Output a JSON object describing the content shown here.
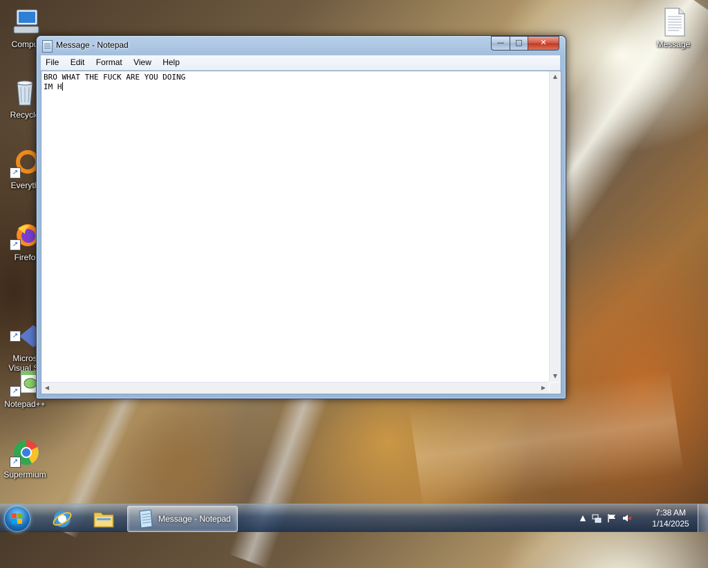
{
  "desktop": {
    "icons": [
      {
        "label": "Compu",
        "icon": "computer-icon"
      },
      {
        "label": "Recycle",
        "icon": "recycle-bin-icon"
      },
      {
        "label": "Everyth",
        "icon": "everything-search-icon"
      },
      {
        "label": "Firefo",
        "icon": "firefox-icon"
      },
      {
        "label": "Micros\nVisual St",
        "icon": "visual-studio-icon"
      },
      {
        "label": "Notepad++",
        "icon": "notepad-plus-plus-icon"
      },
      {
        "label": "Supermium",
        "icon": "supermium-browser-icon"
      },
      {
        "label": "Message",
        "icon": "text-file-icon"
      }
    ]
  },
  "window": {
    "title": "Message - Notepad",
    "controls": {
      "minimize": "—",
      "maximize": "□",
      "close": "✕"
    },
    "menu": [
      "File",
      "Edit",
      "Format",
      "View",
      "Help"
    ],
    "content_line1": "BRO WHAT THE FUCK ARE YOU DOING",
    "content_line2": "IM H"
  },
  "taskbar": {
    "active_task": "Message - Notepad",
    "clock_time": "7:38 AM",
    "clock_date": "1/14/2025",
    "tray_icons": [
      "show-hidden-icons-arrow",
      "network-icon",
      "action-center-flag-icon",
      "volume-muted-icon"
    ],
    "pinned": [
      "internet-explorer-icon",
      "windows-explorer-icon",
      "notepad-icon"
    ]
  },
  "colors": {
    "title_bar": "#a2bedd",
    "close_button": "#c3361e",
    "taskbar": "#1d3557",
    "start_orb": "#1a6db8"
  }
}
